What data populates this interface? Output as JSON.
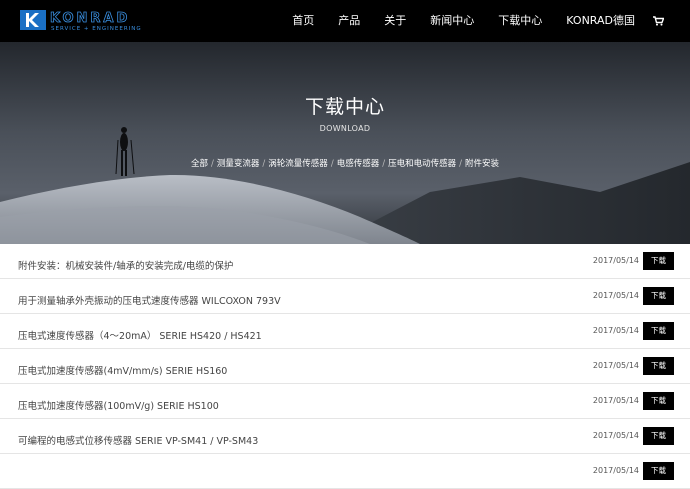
{
  "header": {
    "logo_text": "KONRAD",
    "logo_tagline": "SERVICE + ENGINEERING",
    "nav": [
      {
        "label": "首页"
      },
      {
        "label": "产品"
      },
      {
        "label": "关于"
      },
      {
        "label": "新闻中心"
      },
      {
        "label": "下载中心"
      },
      {
        "label": "KONRAD德国"
      }
    ],
    "cart_icon": "cart-icon"
  },
  "hero": {
    "title": "下载中心",
    "subtitle": "DOWNLOAD",
    "breadcrumbs": [
      {
        "label": "全部"
      },
      {
        "label": "测量变流器"
      },
      {
        "label": "涡轮流量传感器"
      },
      {
        "label": "电感传感器"
      },
      {
        "label": "压电和电动传感器"
      },
      {
        "label": "附件安装"
      }
    ],
    "separator": "/"
  },
  "downloads": [
    {
      "title": "附件安装：机械安装件/轴承的安装完成/电缆的保护",
      "date": "2017/05/14",
      "button": "下载"
    },
    {
      "title": "用于测量轴承外壳振动的压电式速度传感器 WILCOXON 793V",
      "date": "2017/05/14",
      "button": "下载"
    },
    {
      "title": "压电式速度传感器（4～20mA） SERIE HS420 / HS421",
      "date": "2017/05/14",
      "button": "下载"
    },
    {
      "title": "压电式加速度传感器(4mV/mm/s) SERIE HS160",
      "date": "2017/05/14",
      "button": "下载"
    },
    {
      "title": "压电式加速度传感器(100mV/g) SERIE HS100",
      "date": "2017/05/14",
      "button": "下载"
    },
    {
      "title": "可编程的电感式位移传感器 SERIE VP-SM41 / VP-SM43",
      "date": "2017/05/14",
      "button": "下载"
    },
    {
      "title": "",
      "date": "2017/05/14",
      "button": "下载"
    }
  ]
}
